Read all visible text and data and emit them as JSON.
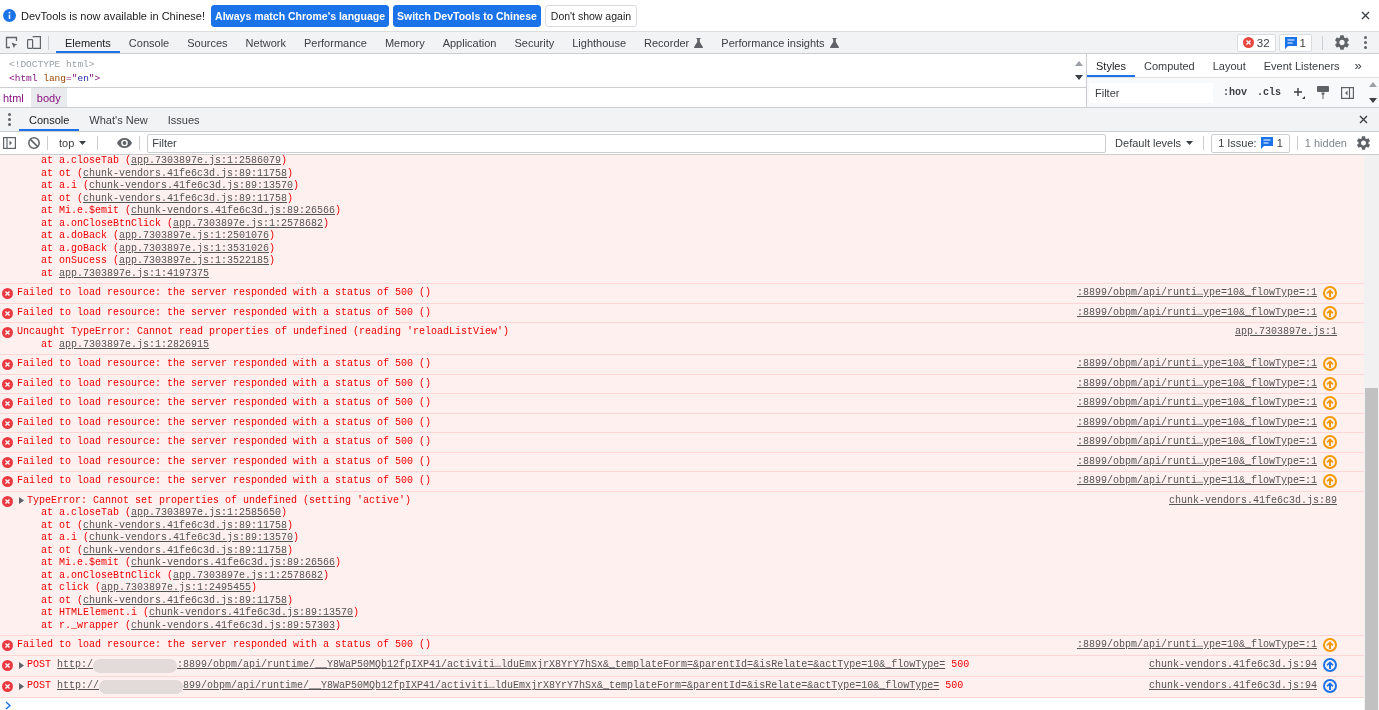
{
  "infobar": {
    "message": "DevTools is now available in Chinese!",
    "buttons": [
      {
        "label": "Always match Chrome's language",
        "primary": true
      },
      {
        "label": "Switch DevTools to Chinese",
        "primary": true
      },
      {
        "label": "Don't show again",
        "primary": false
      }
    ]
  },
  "main_tabs": [
    {
      "label": "Elements",
      "selected": true,
      "experimental": false
    },
    {
      "label": "Console",
      "selected": false,
      "experimental": false
    },
    {
      "label": "Sources",
      "selected": false,
      "experimental": false
    },
    {
      "label": "Network",
      "selected": false,
      "experimental": false
    },
    {
      "label": "Performance",
      "selected": false,
      "experimental": false
    },
    {
      "label": "Memory",
      "selected": false,
      "experimental": false
    },
    {
      "label": "Application",
      "selected": false,
      "experimental": false
    },
    {
      "label": "Security",
      "selected": false,
      "experimental": false
    },
    {
      "label": "Lighthouse",
      "selected": false,
      "experimental": false
    },
    {
      "label": "Recorder",
      "selected": false,
      "experimental": true
    },
    {
      "label": "Performance insights",
      "selected": false,
      "experimental": true
    }
  ],
  "counters": {
    "errors": "32",
    "issues": "1"
  },
  "dom_tree": [
    {
      "segments": [
        {
          "kind": "doctype",
          "text": "<!DOCTYPE html>"
        }
      ]
    },
    {
      "segments": [
        {
          "kind": "tag",
          "text": "<html"
        },
        {
          "kind": "attr-name",
          "text": " lang"
        },
        {
          "kind": "tag",
          "text": "=\""
        },
        {
          "kind": "attr-value",
          "text": "en"
        },
        {
          "kind": "tag",
          "text": "\">"
        }
      ]
    }
  ],
  "breadcrumbs": [
    {
      "label": "html",
      "selected": false
    },
    {
      "label": "body",
      "selected": true
    }
  ],
  "styles_pane": {
    "tabs": [
      {
        "label": "Styles",
        "selected": true
      },
      {
        "label": "Computed",
        "selected": false
      },
      {
        "label": "Layout",
        "selected": false
      },
      {
        "label": "Event Listeners",
        "selected": false
      }
    ],
    "more": "»",
    "filter_placeholder": "Filter",
    "hov": ":hov",
    "cls": ".cls"
  },
  "drawer_tabs": [
    {
      "label": "Console",
      "selected": true
    },
    {
      "label": "What's New",
      "selected": false
    },
    {
      "label": "Issues",
      "selected": false
    }
  ],
  "console_toolbar": {
    "context": "top",
    "filter_placeholder": "Filter",
    "levels": "Default levels",
    "issues_label": "1 Issue:",
    "issues_count": "1",
    "hidden": "1 hidden"
  },
  "messages": [
    {
      "kind": "stack",
      "stack": [
        {
          "text": "at a.closeTab (",
          "link": "app.7303897e.js:1:2586079",
          "end": ")"
        },
        {
          "text": "at ot (",
          "link": "chunk-vendors.41fe6c3d.js:89:11758",
          "end": ")"
        },
        {
          "text": "at a.i (",
          "link": "chunk-vendors.41fe6c3d.js:89:13570",
          "end": ")"
        },
        {
          "text": "at ot (",
          "link": "chunk-vendors.41fe6c3d.js:89:11758",
          "end": ")"
        },
        {
          "text": "at Mi.e.$emit (",
          "link": "chunk-vendors.41fe6c3d.js:89:26566",
          "end": ")"
        },
        {
          "text": "at a.onCloseBtnClick (",
          "link": "app.7303897e.js:1:2578682",
          "end": ")"
        },
        {
          "text": "at a.doBack (",
          "link": "app.7303897e.js:1:2501076",
          "end": ")"
        },
        {
          "text": "at a.goBack (",
          "link": "app.7303897e.js:1:3531026",
          "end": ")"
        },
        {
          "text": "at onSucess (",
          "link": "app.7303897e.js:1:3522185",
          "end": ")"
        },
        {
          "text": "at ",
          "link": "app.7303897e.js:1:4197375"
        }
      ]
    },
    {
      "kind": "error",
      "text": "Failed to load resource: the server responded with a status of 500 ()",
      "source": {
        "link": ":8899/obpm/api/runti…ype=10&_flowType=:1",
        "color": "#f29900"
      }
    },
    {
      "kind": "error",
      "text": "Failed to load resource: the server responded with a status of 500 ()",
      "source": {
        "link": ":8899/obpm/api/runti…ype=10&_flowType=:1",
        "color": "#f29900"
      }
    },
    {
      "kind": "error",
      "text": "Uncaught TypeError: Cannot read properties of undefined (reading 'reloadListView')",
      "stack": [
        {
          "text": "at ",
          "link": "app.7303897e.js:1:2826915"
        }
      ],
      "source": {
        "link": "app.7303897e.js:1"
      }
    },
    {
      "kind": "error",
      "text": "Failed to load resource: the server responded with a status of 500 ()",
      "source": {
        "link": ":8899/obpm/api/runti…ype=10&_flowType=:1",
        "color": "#f29900"
      }
    },
    {
      "kind": "error",
      "text": "Failed to load resource: the server responded with a status of 500 ()",
      "source": {
        "link": ":8899/obpm/api/runti…ype=10&_flowType=:1",
        "color": "#f29900"
      }
    },
    {
      "kind": "error",
      "text": "Failed to load resource: the server responded with a status of 500 ()",
      "source": {
        "link": ":8899/obpm/api/runti…ype=10&_flowType=:1",
        "color": "#f29900"
      }
    },
    {
      "kind": "error",
      "text": "Failed to load resource: the server responded with a status of 500 ()",
      "source": {
        "link": ":8899/obpm/api/runti…ype=10&_flowType=:1",
        "color": "#f29900"
      }
    },
    {
      "kind": "error",
      "text": "Failed to load resource: the server responded with a status of 500 ()",
      "source": {
        "link": ":8899/obpm/api/runti…ype=10&_flowType=:1",
        "color": "#f29900"
      }
    },
    {
      "kind": "error",
      "text": "Failed to load resource: the server responded with a status of 500 ()",
      "source": {
        "link": ":8899/obpm/api/runti…ype=10&_flowType=:1",
        "color": "#f29900"
      }
    },
    {
      "kind": "error",
      "text": "Failed to load resource: the server responded with a status of 500 ()",
      "source": {
        "link": ":8899/obpm/api/runti…ype=11&_flowType=:1",
        "color": "#f29900"
      }
    },
    {
      "kind": "error",
      "expanded": false,
      "text": "TypeError: Cannot set properties of undefined (setting 'active')",
      "stack": [
        {
          "text": "at a.closeTab (",
          "link": "app.7303897e.js:1:2585650",
          "end": ")"
        },
        {
          "text": "at ot (",
          "link": "chunk-vendors.41fe6c3d.js:89:11758",
          "end": ")"
        },
        {
          "text": "at a.i (",
          "link": "chunk-vendors.41fe6c3d.js:89:13570",
          "end": ")"
        },
        {
          "text": "at ot (",
          "link": "chunk-vendors.41fe6c3d.js:89:11758",
          "end": ")"
        },
        {
          "text": "at Mi.e.$emit (",
          "link": "chunk-vendors.41fe6c3d.js:89:26566",
          "end": ")"
        },
        {
          "text": "at a.onCloseBtnClick (",
          "link": "app.7303897e.js:1:2578682",
          "end": ")"
        },
        {
          "text": "at click (",
          "link": "app.7303897e.js:1:2495455",
          "end": ")"
        },
        {
          "text": "at ot (",
          "link": "chunk-vendors.41fe6c3d.js:89:11758",
          "end": ")"
        },
        {
          "text": "at HTMLElement.i (",
          "link": "chunk-vendors.41fe6c3d.js:89:13570",
          "end": ")"
        },
        {
          "text": "at r._wrapper (",
          "link": "chunk-vendors.41fe6c3d.js:89:57303",
          "end": ")"
        }
      ],
      "source": {
        "link": "chunk-vendors.41fe6c3d.js:89"
      }
    },
    {
      "kind": "error",
      "text": "Failed to load resource: the server responded with a status of 500 ()",
      "source": {
        "link": ":8899/obpm/api/runti…ype=10&_flowType=:1",
        "color": "#f29900"
      }
    },
    {
      "kind": "request",
      "expanded": false,
      "method": "POST",
      "url_start": "http:/",
      "redacted": true,
      "url_end": ":8899/obpm/api/runtime/__Y8WaP50MQb12fpIXP41/activiti…lduEmxjrX8YrY7hSx&_templateForm=&parentId=&isRelate=&actType=10&_flowType=",
      "status": "500",
      "source": {
        "link": "chunk-vendors.41fe6c3d.js:94",
        "color": "#1a73e8"
      }
    },
    {
      "kind": "request",
      "expanded": false,
      "method": "POST",
      "url_start": "http://",
      "redacted": true,
      "url_end": "899/obpm/api/runtime/__Y8WaP50MQb12fpIXP41/activiti…lduEmxjrX8YrY7hSx&_templateForm=&parentId=&isRelate=&actType=10&_flowType=",
      "status": "500",
      "source": {
        "link": "chunk-vendors.41fe6c3d.js:94",
        "color": "#1a73e8"
      }
    }
  ]
}
